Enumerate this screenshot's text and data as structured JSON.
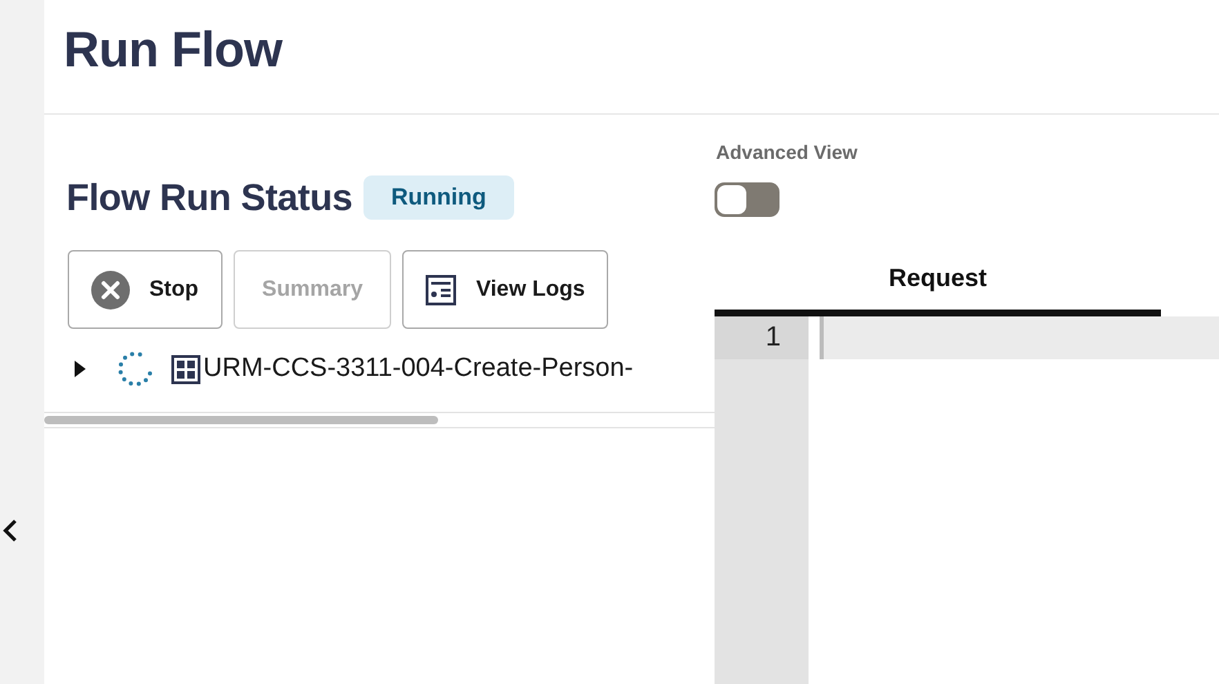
{
  "page": {
    "title": "Run Flow"
  },
  "status": {
    "heading": "Flow Run Status",
    "badge": "Running"
  },
  "buttons": [
    {
      "label": "Stop",
      "kind": "stop",
      "disabled": false
    },
    {
      "label": "Summary",
      "kind": "summary",
      "disabled": true
    },
    {
      "label": "View Logs",
      "kind": "logs",
      "disabled": false
    }
  ],
  "tree": [
    {
      "label": "URM-CCS-3311-004-Create-Person-",
      "expanded": false
    }
  ],
  "advanced_view": {
    "label": "Advanced View",
    "on": false
  },
  "editor_tabs": [
    {
      "label": "Request",
      "selected": true
    }
  ],
  "editor": {
    "line_numbers": [
      "1"
    ]
  }
}
